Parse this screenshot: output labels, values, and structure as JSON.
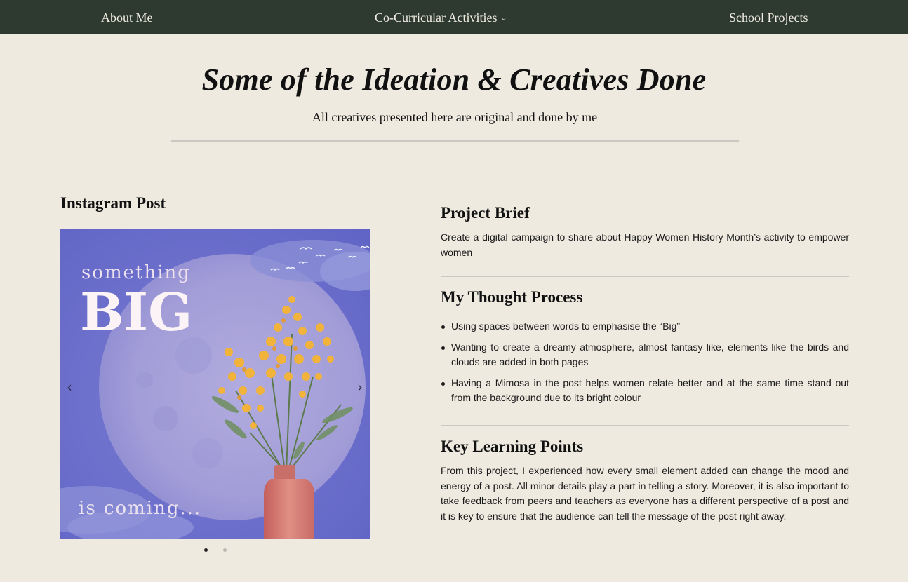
{
  "nav": {
    "items": [
      {
        "label": "About Me"
      },
      {
        "label": "Co-Curricular Activities",
        "chevron": "⌄"
      },
      {
        "label": "School Projects"
      }
    ]
  },
  "header": {
    "title": "Some of the Ideation & Creatives Done",
    "subtitle": "All creatives presented here are original and done by me"
  },
  "post": {
    "heading": "Instagram Post",
    "carousel": {
      "prev_icon": "‹",
      "next_icon": "›",
      "slide_count": 2,
      "active_slide": 1,
      "slide": {
        "line1": "something",
        "line2": "BIG",
        "line3": "is coming..."
      }
    }
  },
  "sections": {
    "brief": {
      "heading": "Project Brief",
      "text": "Create a digital campaign to share about Happy Women History Month’s activity to empower women"
    },
    "thought": {
      "heading": "My Thought Process",
      "bullets": [
        "Using spaces between words to emphasise the “Big”",
        "Wanting to create a dreamy atmosphere, almost fantasy like, elements like the birds and clouds are added in both pages",
        "Having a Mimosa in the post helps women relate better and at the same time stand out from the background due to its bright colour"
      ]
    },
    "key": {
      "heading": "Key Learning Points",
      "text": "From this project, I experienced how every small element added can change the mood and energy of a post. All minor details play a part in telling a story. Moreover, it is also important to take feedback from peers and teachers as everyone has a different perspective of a post and it is key to ensure that the audience can tell the message of the post right away."
    }
  },
  "colors": {
    "background": "#efeae0",
    "nav": "#2e3a2f",
    "slide_bg": "#6d6fc9",
    "flower": "#f2b33a",
    "vase": "#d27a70"
  }
}
